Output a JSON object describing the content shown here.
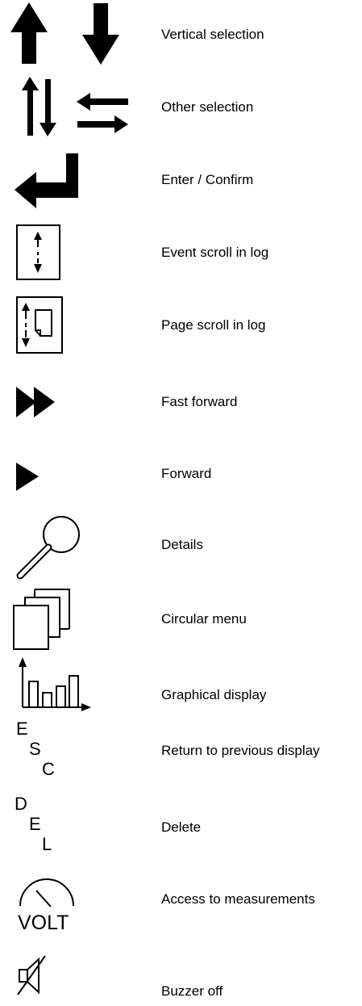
{
  "legend": [
    {
      "icon": "vertical-arrows-icon",
      "label": "Vertical selection"
    },
    {
      "icon": "swap-arrows-icon",
      "label": "Other selection"
    },
    {
      "icon": "enter-arrow-icon",
      "label": "Enter / Confirm"
    },
    {
      "icon": "event-scroll-icon",
      "label": "Event scroll in log"
    },
    {
      "icon": "page-scroll-icon",
      "label": "Page scroll in log"
    },
    {
      "icon": "fast-forward-icon",
      "label": "Fast forward"
    },
    {
      "icon": "forward-icon",
      "label": "Forward"
    },
    {
      "icon": "magnifier-icon",
      "label": "Details"
    },
    {
      "icon": "stacked-pages-icon",
      "label": "Circular menu"
    },
    {
      "icon": "bar-chart-icon",
      "label": "Graphical display"
    },
    {
      "icon": "esc-icon",
      "label": "Return to previous display",
      "letters": [
        "E",
        "S",
        "C"
      ]
    },
    {
      "icon": "del-icon",
      "label": "Delete",
      "letters": [
        "D",
        "E",
        "L"
      ]
    },
    {
      "icon": "voltmeter-icon",
      "label": "Access to measurements",
      "letters": [
        "VOLT"
      ]
    },
    {
      "icon": "buzzer-off-icon",
      "label": "Buzzer off"
    }
  ]
}
